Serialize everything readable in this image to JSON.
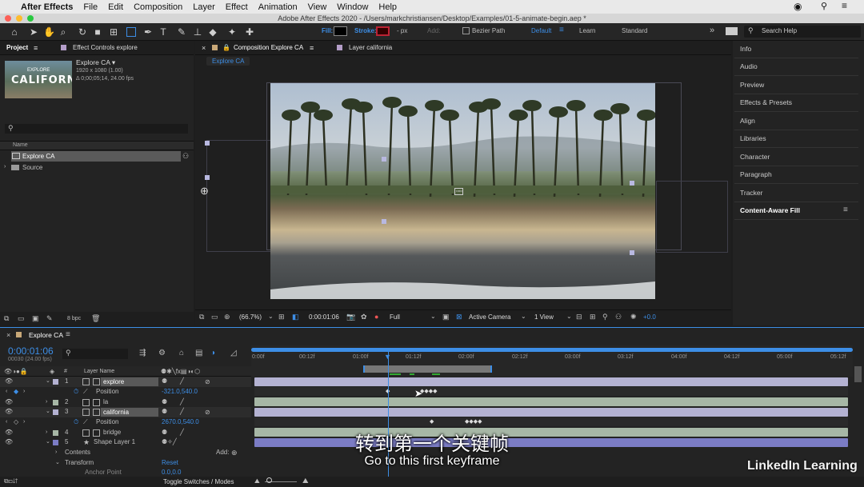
{
  "menubar": {
    "app": "After Effects",
    "items": [
      "File",
      "Edit",
      "Composition",
      "Layer",
      "Effect",
      "Animation",
      "View",
      "Window",
      "Help"
    ]
  },
  "window_title": "Adobe After Effects 2020 - /Users/markchristiansen/Desktop/Examples/01-5-animate-begin.aep *",
  "toolbar": {
    "fill_label": "Fill:",
    "stroke_label": "Stroke:",
    "stroke_px": "- px",
    "add_label": "Add:",
    "bezier": "Bezier Path",
    "workspaces": [
      "Default",
      "Learn",
      "Standard"
    ],
    "search": "Search Help"
  },
  "project": {
    "tab": "Project",
    "effect_tab": "Effect Controls explore",
    "comp_name": "Explore CA ▾",
    "comp_info1": "1920 x 1080 (1.00)",
    "comp_info2": "Δ 0;00;05;14, 24.00 fps",
    "thumb_text": "CALIFORNIA",
    "thumb_small": "EXPLORE",
    "col_name": "Name",
    "items": [
      "Explore CA",
      "Source"
    ],
    "bpc": "8 bpc"
  },
  "viewer": {
    "tab": "Composition Explore CA",
    "layer_tab": "Layer california",
    "sub_tab": "Explore CA",
    "zoom": "(66.7%)",
    "time": "0:00:01:06",
    "res": "Full",
    "camera": "Active Camera",
    "view": "1 View",
    "exposure": "+0.0"
  },
  "right_panels": [
    "Info",
    "Audio",
    "Preview",
    "Effects & Presets",
    "Align",
    "Libraries",
    "Character",
    "Paragraph",
    "Tracker",
    "Content-Aware Fill"
  ],
  "timeline": {
    "tab": "Explore CA",
    "time": "0:00:01:06",
    "frames": "00030 (24.00 fps)",
    "layer_col": "Layer Name",
    "ruler": [
      "0:00f",
      "00:12f",
      "01:00f",
      "01:12f",
      "02:00f",
      "02:12f",
      "03:00f",
      "03:12f",
      "04:00f",
      "04:12f",
      "05:00f",
      "05:12f"
    ],
    "layers": [
      {
        "num": "1",
        "name": "explore",
        "prop": "Position",
        "val": "-321.0,540.0"
      },
      {
        "num": "2",
        "name": "la"
      },
      {
        "num": "3",
        "name": "california",
        "prop": "Position",
        "val": "2670.0,540.0"
      },
      {
        "num": "4",
        "name": "bridge"
      },
      {
        "num": "5",
        "name": "Shape Layer 1"
      }
    ],
    "contents": "Contents",
    "add": "Add:",
    "transform": "Transform",
    "reset": "Reset",
    "anchor": "Anchor Point",
    "anchor_val": "0.0,0.0",
    "toggle": "Toggle Switches / Modes"
  },
  "subtitle": {
    "zh": "转到第一个关键帧",
    "en": "Go to this first keyframe"
  },
  "watermark": "LinkedIn Learning",
  "colors": {
    "accent": "#2d8ceb",
    "layer_bar": "#b4b2d2",
    "shape_bar": "#7b7cc4",
    "track_bar": "#a7b7a6"
  }
}
